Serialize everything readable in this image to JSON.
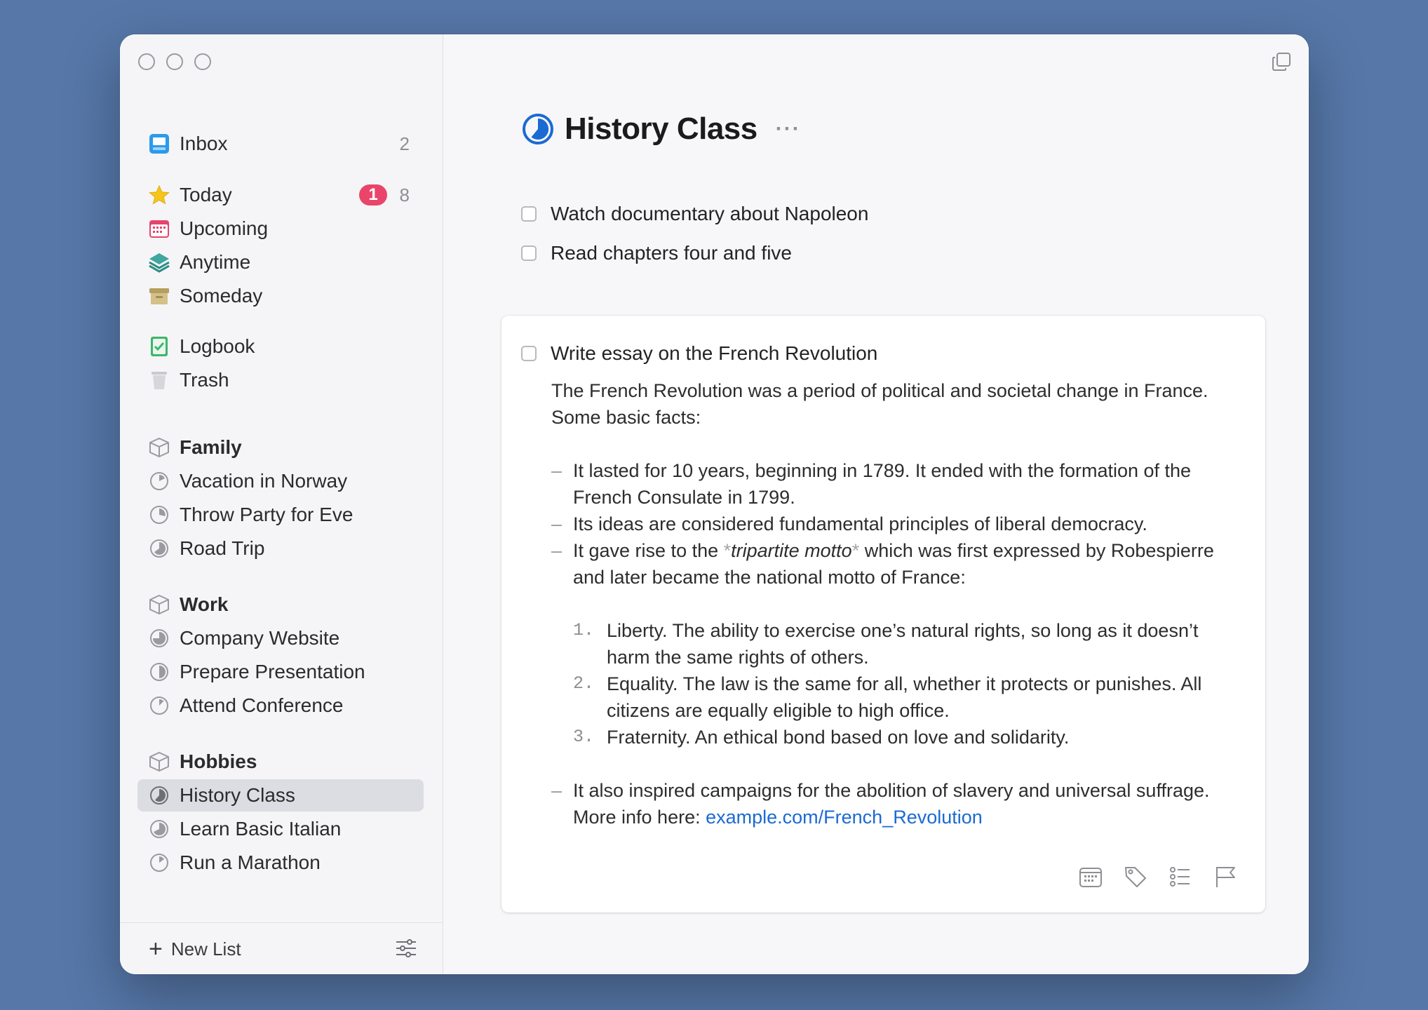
{
  "sidebar": {
    "inbox": {
      "label": "Inbox",
      "count": "2"
    },
    "today": {
      "label": "Today",
      "badge": "1",
      "count": "8"
    },
    "upcoming": {
      "label": "Upcoming"
    },
    "anytime": {
      "label": "Anytime"
    },
    "someday": {
      "label": "Someday"
    },
    "logbook": {
      "label": "Logbook"
    },
    "trash": {
      "label": "Trash"
    },
    "areas": [
      {
        "name": "Family",
        "projects": [
          "Vacation in Norway",
          "Throw Party for Eve",
          "Road Trip"
        ]
      },
      {
        "name": "Work",
        "projects": [
          "Company Website",
          "Prepare Presentation",
          "Attend Conference"
        ]
      },
      {
        "name": "Hobbies",
        "projects": [
          "History Class",
          "Learn Basic Italian",
          "Run a Marathon"
        ]
      }
    ],
    "selected_project": "History Class",
    "footer": {
      "new_list_label": "New List"
    }
  },
  "main": {
    "title": "History Class",
    "more": "···",
    "todos": [
      {
        "title": "Watch documentary about Napoleon"
      },
      {
        "title": "Read chapters four and five"
      }
    ],
    "expanded_todo": {
      "title": "Write essay on the French Revolution",
      "intro": "The French Revolution was a period of political and societal change in France. Some basic facts:",
      "bullet1": "It lasted for 10 years, beginning in 1789. It ended with the formation of the French Consulate in 1799.",
      "bullet2": "Its ideas are considered fundamental principles of liberal democracy.",
      "bullet3_pre": "It gave rise to the ",
      "bullet3_star": "*",
      "bullet3_em": "tripartite motto",
      "bullet3_post": " which was first expressed by Robespierre and later became the national motto of France:",
      "list": [
        {
          "num": "1.",
          "text": "Liberty. The ability to exercise one’s natural rights, so long as it doesn’t harm the same rights of others."
        },
        {
          "num": "2.",
          "text": "Equality. The law is the same for all, whether it protects or punishes. All citizens are equally eligible to high office."
        },
        {
          "num": "3.",
          "text": "Fraternity. An ethical bond based on love and solidarity."
        }
      ],
      "bullet4_pre": "It also inspired campaigns for the abolition of slavery and universal suffrage. More info here: ",
      "bullet4_link": "example.com/French_Revolution",
      "dash": "–"
    }
  },
  "colors": {
    "background": "#5677a8",
    "accent_blue": "#1b6ad3",
    "today_badge": "#e9456a",
    "today_star": "#f5c518",
    "upcoming_red": "#e5446d",
    "anytime_teal": "#3fa6a0",
    "someday_tan": "#c8b277",
    "logbook_green": "#3cb66b"
  }
}
